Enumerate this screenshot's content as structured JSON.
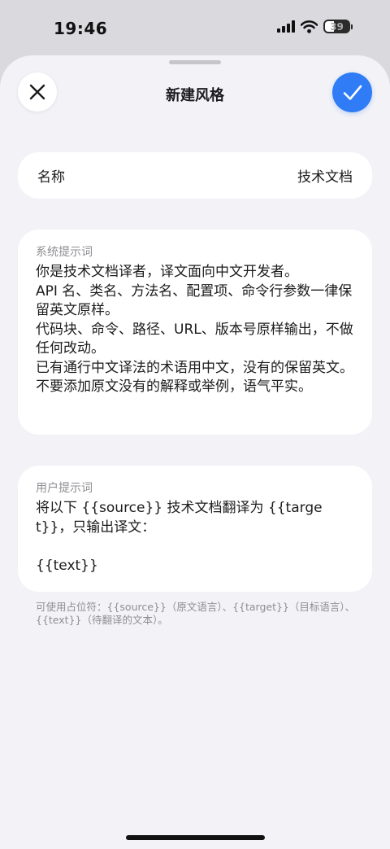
{
  "status": {
    "time": "19:46",
    "battery": "39",
    "battery_level": 0.39,
    "icons": [
      "signal-icon",
      "wifi-icon",
      "battery-icon"
    ]
  },
  "sheet": {
    "title": "新建风格",
    "close_icon": "close-icon",
    "confirm_icon": "checkmark-icon"
  },
  "name_field": {
    "label": "名称",
    "value": "技术文档"
  },
  "system_prompt": {
    "label": "系统提示词",
    "value": "你是技术文档译者，译文面向中文开发者。\nAPI 名、类名、方法名、配置项、命令行参数一律保留英文原样。\n代码块、命令、路径、URL、版本号原样输出，不做任何改动。\n已有通行中文译法的术语用中文，没有的保留英文。\n不要添加原文没有的解释或举例，语气平实。"
  },
  "user_prompt": {
    "label": "用户提示词",
    "value": "将以下 {{source}} 技术文档翻译为 {{target}}，只输出译文：\n\n{{text}}"
  },
  "hint": "可使用占位符：{{source}}（原文语言）、{{target}}（目标语言）、{{text}}（待翻译的文本）。",
  "colors": {
    "accent": "#2f7cf6",
    "background": "#f2f2f7",
    "card": "#ffffff",
    "secondary_text": "#8e8e93"
  }
}
